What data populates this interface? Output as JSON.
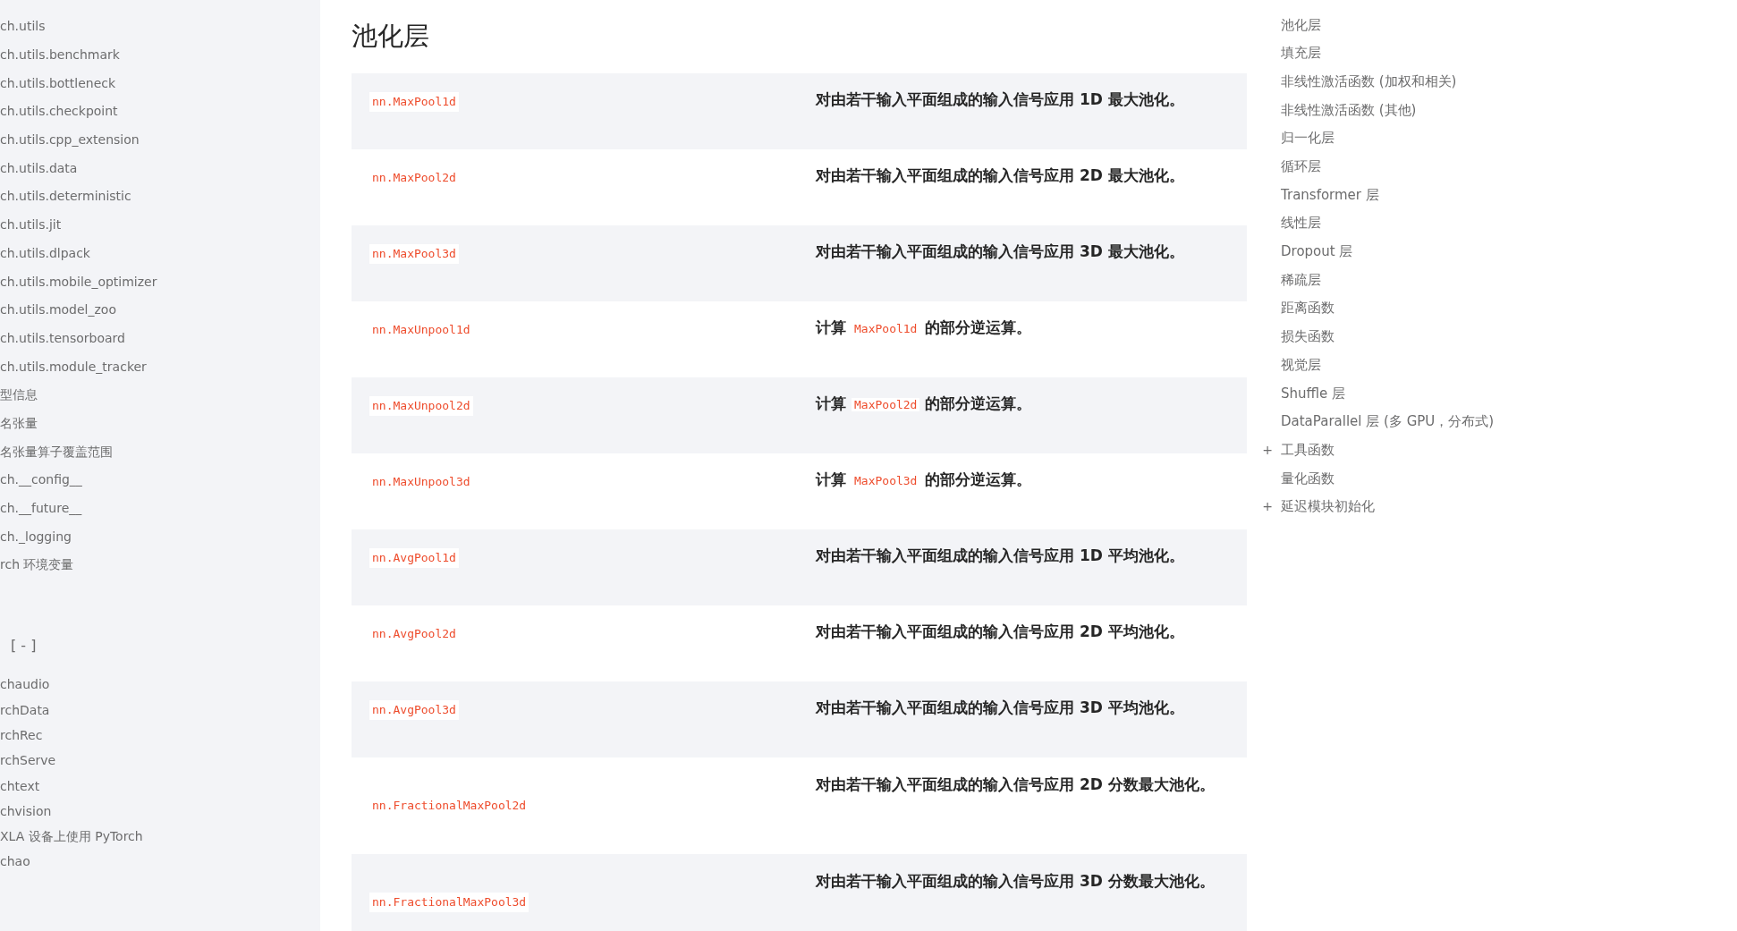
{
  "sidebar": {
    "items": [
      {
        "label": "ch.utils"
      },
      {
        "label": "ch.utils.benchmark"
      },
      {
        "label": "ch.utils.bottleneck"
      },
      {
        "label": "ch.utils.checkpoint"
      },
      {
        "label": "ch.utils.cpp_extension"
      },
      {
        "label": "ch.utils.data"
      },
      {
        "label": "ch.utils.deterministic"
      },
      {
        "label": "ch.utils.jit"
      },
      {
        "label": "ch.utils.dlpack"
      },
      {
        "label": "ch.utils.mobile_optimizer"
      },
      {
        "label": "ch.utils.model_zoo"
      },
      {
        "label": "ch.utils.tensorboard"
      },
      {
        "label": "ch.utils.module_tracker"
      },
      {
        "label": "型信息"
      },
      {
        "label": "名张量"
      },
      {
        "label": "名张量算子覆盖范围"
      },
      {
        "label": "ch.__config__"
      },
      {
        "label": "ch.__future__"
      },
      {
        "label": "ch._logging"
      },
      {
        "label": "rch 环境变量"
      }
    ],
    "collapse_toggle": "[ - ]",
    "libraries": [
      {
        "label": "chaudio"
      },
      {
        "label": "rchData"
      },
      {
        "label": "rchRec"
      },
      {
        "label": "rchServe"
      },
      {
        "label": "chtext"
      },
      {
        "label": "chvision"
      },
      {
        "label": "XLA 设备上使用 PyTorch"
      },
      {
        "label": "chao"
      }
    ]
  },
  "content": {
    "heading": "池化层",
    "rows": [
      {
        "name": "nn.MaxPool1d",
        "description": [
          {
            "kind": "text",
            "text": "对由若干输入平面组成的输入信号应用 1D 最大池化。"
          }
        ]
      },
      {
        "name": "nn.MaxPool2d",
        "description": [
          {
            "kind": "text",
            "text": "对由若干输入平面组成的输入信号应用 2D 最大池化。"
          }
        ]
      },
      {
        "name": "nn.MaxPool3d",
        "description": [
          {
            "kind": "text",
            "text": "对由若干输入平面组成的输入信号应用 3D 最大池化。"
          }
        ]
      },
      {
        "name": "nn.MaxUnpool1d",
        "description": [
          {
            "kind": "text",
            "text": "计算"
          },
          {
            "kind": "code",
            "text": "MaxPool1d"
          },
          {
            "kind": "text",
            "text": "的部分逆运算。"
          }
        ]
      },
      {
        "name": "nn.MaxUnpool2d",
        "description": [
          {
            "kind": "text",
            "text": "计算"
          },
          {
            "kind": "code",
            "text": "MaxPool2d"
          },
          {
            "kind": "text",
            "text": "的部分逆运算。"
          }
        ]
      },
      {
        "name": "nn.MaxUnpool3d",
        "description": [
          {
            "kind": "text",
            "text": "计算"
          },
          {
            "kind": "code",
            "text": "MaxPool3d"
          },
          {
            "kind": "text",
            "text": "的部分逆运算。"
          }
        ]
      },
      {
        "name": "nn.AvgPool1d",
        "description": [
          {
            "kind": "text",
            "text": "对由若干输入平面组成的输入信号应用 1D 平均池化。"
          }
        ]
      },
      {
        "name": "nn.AvgPool2d",
        "description": [
          {
            "kind": "text",
            "text": "对由若干输入平面组成的输入信号应用 2D 平均池化。"
          }
        ]
      },
      {
        "name": "nn.AvgPool3d",
        "description": [
          {
            "kind": "text",
            "text": "对由若干输入平面组成的输入信号应用 3D 平均池化。"
          }
        ]
      },
      {
        "name": "nn.FractionalMaxPool2d",
        "description": [
          {
            "kind": "text",
            "text": "对由若干输入平面组成的输入信号应用 2D 分数最大池化。"
          }
        ]
      },
      {
        "name": "nn.FractionalMaxPool3d",
        "description": [
          {
            "kind": "text",
            "text": "对由若干输入平面组成的输入信号应用 3D 分数最大池化。"
          }
        ]
      }
    ]
  },
  "toc": {
    "items": [
      {
        "label": "池化层"
      },
      {
        "label": "填充层"
      },
      {
        "label": "非线性激活函数 (加权和相关)"
      },
      {
        "label": "非线性激活函数 (其他)"
      },
      {
        "label": "归一化层"
      },
      {
        "label": "循环层"
      },
      {
        "label": "Transformer 层"
      },
      {
        "label": "线性层"
      },
      {
        "label": "Dropout 层"
      },
      {
        "label": "稀疏层"
      },
      {
        "label": "距离函数"
      },
      {
        "label": "损失函数"
      },
      {
        "label": "视觉层"
      },
      {
        "label": "Shuffle 层"
      },
      {
        "label": "DataParallel 层 (多 GPU，分布式)"
      },
      {
        "label": "工具函数",
        "toggle": "+"
      },
      {
        "label": "量化函数"
      },
      {
        "label": "延迟模块初始化",
        "toggle": "+"
      }
    ]
  }
}
